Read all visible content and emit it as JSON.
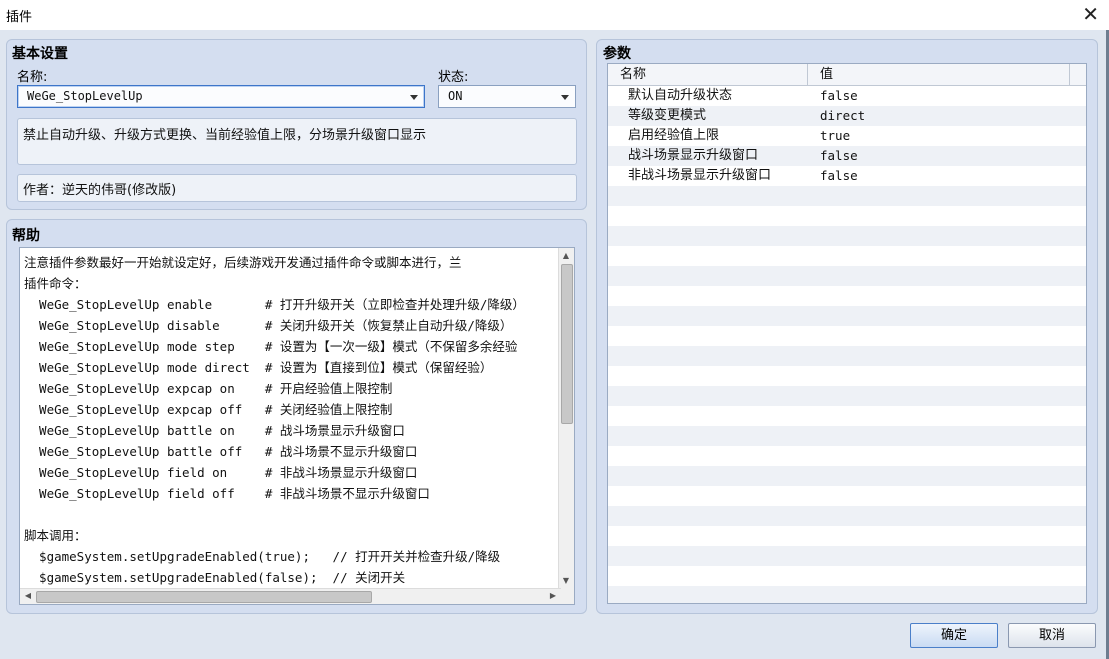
{
  "window": {
    "title": "插件",
    "close_glyph": "✕"
  },
  "basic": {
    "title": "基本设置",
    "name_label": "名称:",
    "name_value": "WeGe_StopLevelUp",
    "status_label": "状态:",
    "status_value": "ON",
    "description": "禁止自动升级、升级方式更换、当前经验值上限，分场景升级窗口显示",
    "author": "作者：逆天的伟哥(修改版)"
  },
  "help": {
    "title": "帮助",
    "lines": [
      "注意插件参数最好一开始就设定好，后续游戏开发通过插件命令或脚本进行，兰",
      "插件命令：",
      "  WeGe_StopLevelUp enable       # 打开升级开关（立即检查并处理升级/降级）",
      "  WeGe_StopLevelUp disable      # 关闭升级开关（恢复禁止自动升级/降级）",
      "  WeGe_StopLevelUp mode step    # 设置为【一次一级】模式（不保留多余经验",
      "  WeGe_StopLevelUp mode direct  # 设置为【直接到位】模式（保留经验）",
      "  WeGe_StopLevelUp expcap on    # 开启经验值上限控制",
      "  WeGe_StopLevelUp expcap off   # 关闭经验值上限控制",
      "  WeGe_StopLevelUp battle on    # 战斗场景显示升级窗口",
      "  WeGe_StopLevelUp battle off   # 战斗场景不显示升级窗口",
      "  WeGe_StopLevelUp field on     # 非战斗场景显示升级窗口",
      "  WeGe_StopLevelUp field off    # 非战斗场景不显示升级窗口",
      "",
      "脚本调用：",
      "  $gameSystem.setUpgradeEnabled(true);   // 打开开关并检查升级/降级",
      "  $gameSystem.setUpgradeEnabled(false);  // 关闭开关"
    ],
    "scroll_up": "▲",
    "scroll_down": "▼",
    "scroll_left": "◀",
    "scroll_right": "▶"
  },
  "params": {
    "title": "参数",
    "col_name": "名称",
    "col_value": "值",
    "rows": [
      {
        "name": "默认自动升级状态",
        "value": "false"
      },
      {
        "name": "等级变更模式",
        "value": "direct"
      },
      {
        "name": "启用经验值上限",
        "value": "true"
      },
      {
        "name": "战斗场景显示升级窗口",
        "value": "false"
      },
      {
        "name": "非战斗场景显示升级窗口",
        "value": "false"
      }
    ],
    "empty_rows": 21
  },
  "buttons": {
    "ok": "确定",
    "cancel": "取消"
  }
}
